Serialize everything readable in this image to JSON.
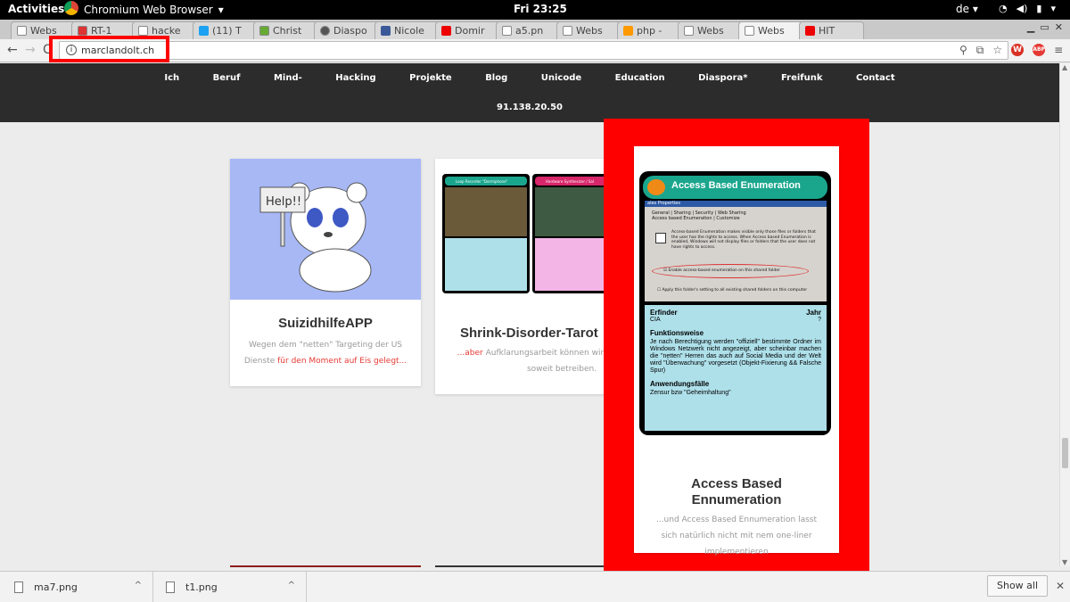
{
  "topbar": {
    "activities": "Activities",
    "app_name": "Chromium Web Browser",
    "clock": "Fri 23:25",
    "lang": "de"
  },
  "tabs": [
    {
      "label": "Webs"
    },
    {
      "label": "RT-1"
    },
    {
      "label": "hacke"
    },
    {
      "label": "(11) T"
    },
    {
      "label": "Christ"
    },
    {
      "label": "Diaspo"
    },
    {
      "label": "Nicole"
    },
    {
      "label": "Domir"
    },
    {
      "label": "a5.pn"
    },
    {
      "label": "Webs"
    },
    {
      "label": "php -"
    },
    {
      "label": "Webs"
    },
    {
      "label": "Webs"
    },
    {
      "label": "HIT"
    }
  ],
  "toolbar": {
    "url": "marclandolt.ch"
  },
  "site_nav": {
    "items": [
      "Ich",
      "Beruf",
      "Mind-",
      "Hacking",
      "Projekte",
      "Blog",
      "Unicode",
      "Education",
      "Diaspora*",
      "Freifunk",
      "Contact"
    ],
    "ip": "91.138.20.50"
  },
  "cards": [
    {
      "title": "SuizidhilfeAPP",
      "excerpt_plain": "Wegen dem \"netten\" Targeting der US",
      "excerpt_plain2": "Dienste ",
      "excerpt_link": "für den Moment auf Eis gelegt...",
      "image_sign_text": "Help!!"
    },
    {
      "title": "Shrink-Disorder-Tarot",
      "excerpt_link": "...aber",
      "excerpt_plain": " Aufklarungsarbeit können wir ma",
      "excerpt_plain2": "soweit betreiben."
    },
    {
      "title_line1": "Access Based",
      "title_line2": "Ennumeration",
      "excerpt_line1": "...und Access Based Ennumeration lasst",
      "excerpt_line2": "sich natürlich nicht mit nem one-liner",
      "excerpt_line3": "implementieren"
    }
  ],
  "tarot": {
    "header": "Access Based Enumeration",
    "dialog_title": "ales Properties",
    "dialog_tabs": "General | Sharing | Security | Web Sharing",
    "dialog_tabs2": "Access based Enumeration | Customize",
    "dialog_text": "Access-based Enumeration makes visible only those files or folders that the user has the rights to access. When Access based Enumeration is enabled, Windows will not display files or folders that the user does not have rights to access.",
    "checkbox1": "Enable access-based enumeration on this shared folder",
    "checkbox2": "Apply this folder's setting to all existing shared folders on this computer",
    "erfinder_label": "Erfinder",
    "jahr_label": "Jahr",
    "erfinder_value": "CIA",
    "jahr_value": "?",
    "funktionsweise_label": "Funktionsweise",
    "funktionsweise_text": "Je nach Berechtigung werden \"offiziell\" bestimmte Ordner im Windows Netzwerk nicht angezeigt, aber scheinbar machen die \"netten\" Herren das auch auf Social Media und der Welt wird \"Überwachung\" vorgesetzt (Objekt-Fixierung && Falsche Spur)",
    "anwendung_label": "Anwendungsfälle",
    "anwendung_text": "Zensur bzw \"Geheimhaltung\""
  },
  "mini_tarots": {
    "left_header": "Loop Recorder \"Dormiphone\"",
    "right_header": "Hardware Synthesizer / Sal"
  },
  "downloads": {
    "items": [
      {
        "name": "ma7.png"
      },
      {
        "name": "t1.png"
      }
    ],
    "show_all": "Show all"
  },
  "colors": {
    "highlight_red": "#ff0000",
    "nav_bg": "#2c2c2c",
    "link_red": "#e53935",
    "tarot_teal": "#1aa68d",
    "tarot_info_bg": "#aee0ea"
  }
}
